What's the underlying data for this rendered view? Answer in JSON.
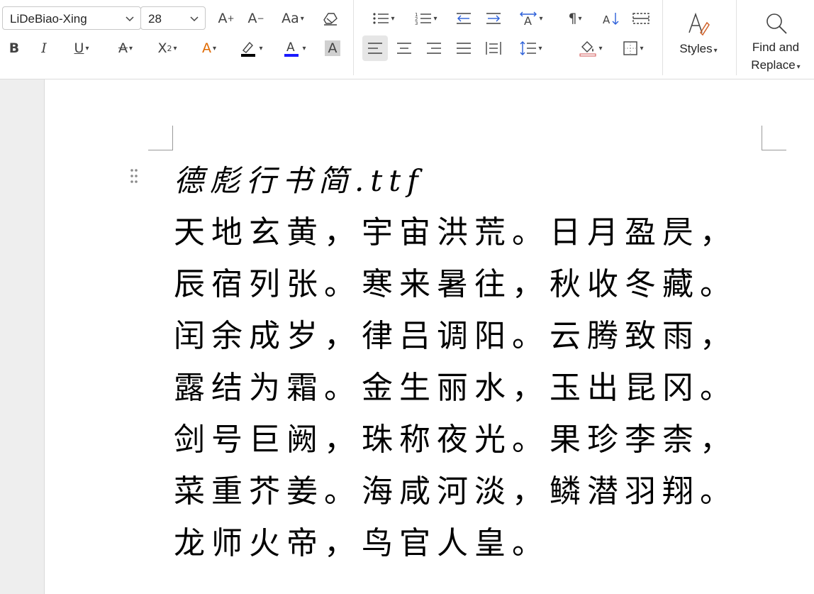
{
  "toolbar": {
    "font_name": "LiDeBiao-Xing",
    "font_size": "28",
    "styles_label": "Styles",
    "find_replace_line1": "Find and",
    "find_replace_line2": "Replace",
    "icons": {
      "row1": [
        "increase-font-size-icon",
        "decrease-font-size-icon",
        "change-case-icon",
        "clear-formatting-icon",
        "bullets-icon",
        "numbering-icon",
        "decrease-indent-icon",
        "increase-indent-icon",
        "text-direction-icon",
        "paragraph-mark-icon",
        "sort-icon",
        "columns-icon"
      ],
      "row2": [
        "bold-icon",
        "italic-icon",
        "underline-icon",
        "strikethrough-icon",
        "superscript-icon",
        "text-effects-icon",
        "highlight-icon",
        "font-color-icon",
        "character-shading-icon",
        "align-left-icon",
        "align-center-icon",
        "align-right-icon",
        "justify-icon",
        "distributed-icon",
        "line-spacing-icon",
        "shading-icon",
        "borders-icon"
      ]
    },
    "colors": {
      "highlight": "#000000",
      "font_color": "#1a1aff"
    }
  },
  "document": {
    "title": "德彪行书简.ttf",
    "lines": [
      "天地玄黄，宇宙洪荒。日月盈昃，",
      "辰宿列张。寒来暑往，秋收冬藏。",
      "闰余成岁，律吕调阳。云腾致雨，",
      "露结为霜。金生丽水，玉出昆冈。",
      "剑号巨阙，珠称夜光。果珍李柰，",
      "菜重芥姜。海咸河淡，鳞潜羽翔。",
      "龙师火帝，鸟官人皇。"
    ]
  }
}
